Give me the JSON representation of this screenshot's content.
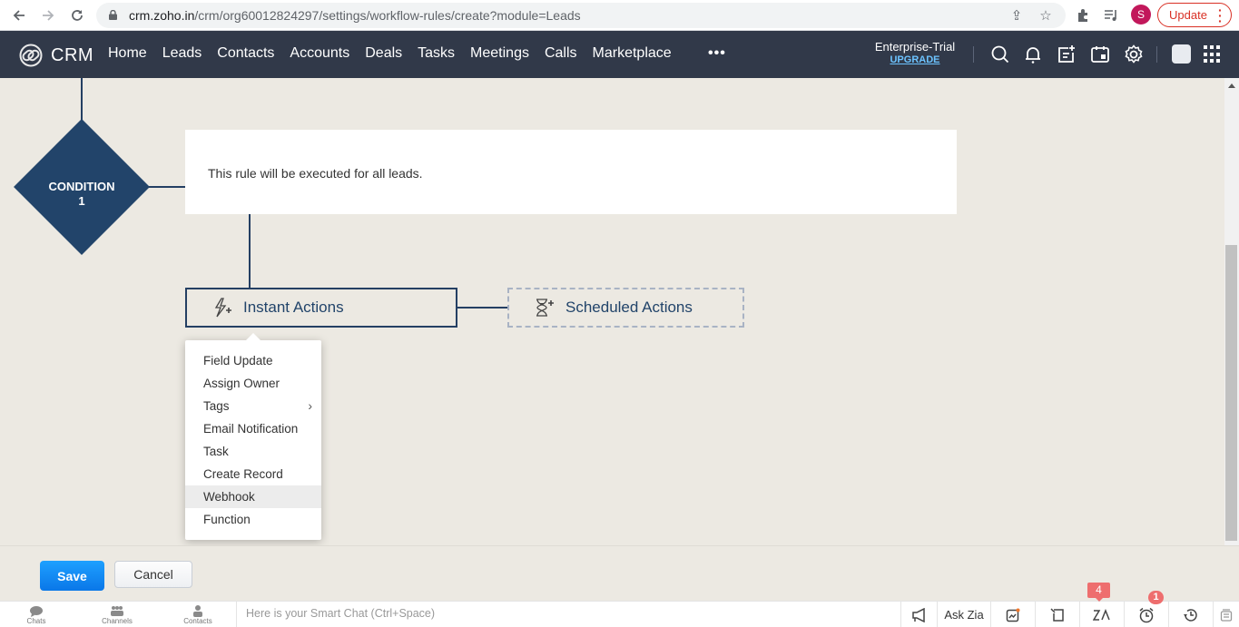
{
  "browser": {
    "url_host": "crm.zoho.in",
    "url_path": "/crm/org60012824297/settings/workflow-rules/create?module=Leads",
    "profile_initial": "S",
    "update_label": "Update",
    "colors": {
      "update": "#d93025",
      "profile": "#c2185b"
    }
  },
  "topbar": {
    "logo_text": "CRM",
    "nav": [
      "Home",
      "Leads",
      "Contacts",
      "Accounts",
      "Deals",
      "Tasks",
      "Meetings",
      "Calls",
      "Marketplace"
    ],
    "more": "•••",
    "edition": "Enterprise-Trial",
    "upgrade": "UPGRADE",
    "icons": [
      "search-icon",
      "bell-icon",
      "add-note-icon",
      "calendar-icon",
      "gear-icon",
      "avatar",
      "apps-grid-icon"
    ],
    "colors": {
      "background": "#313949",
      "upgrade": "#6cc3ff"
    }
  },
  "workflow": {
    "condition_label": "CONDITION",
    "condition_number": "1",
    "rule_text": "This rule will be executed for all leads.",
    "instant_actions": "Instant Actions",
    "scheduled_actions": "Scheduled Actions",
    "menu_items": [
      {
        "label": "Field Update"
      },
      {
        "label": "Assign Owner"
      },
      {
        "label": "Tags",
        "submenu": true
      },
      {
        "label": "Email Notification"
      },
      {
        "label": "Task"
      },
      {
        "label": "Create Record"
      },
      {
        "label": "Webhook",
        "highlighted": true
      },
      {
        "label": "Function"
      }
    ],
    "submenu_chevron": "›",
    "colors": {
      "node": "#22446a",
      "line": "#243f63"
    }
  },
  "footer": {
    "save": "Save",
    "cancel": "Cancel",
    "colors": {
      "save": "#0a8cf5"
    }
  },
  "bottombar": {
    "chats": "Chats",
    "channels": "Channels",
    "contacts": "Contacts",
    "smart_chat_placeholder": "Here is your Smart Chat (Ctrl+Space)",
    "ask_zia": "Ask Zia",
    "zia_badge": "4",
    "alarm_badge": "1"
  }
}
